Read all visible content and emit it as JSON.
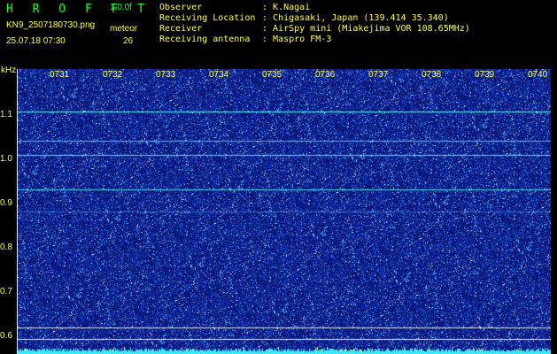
{
  "app": {
    "name": "H R O F F T",
    "version": "1.0.0f"
  },
  "file": {
    "name": "KN9_2507180730.png",
    "mode": "meteor",
    "datetime": "25.07.18 07:30",
    "count": "26"
  },
  "info": [
    {
      "label": "Observer",
      "value": ": K.Nagai"
    },
    {
      "label": "Receiving Location",
      "value": ": Chigasaki, Japan (139.414 35.340)"
    },
    {
      "label": "Receiver",
      "value": ": AirSpy mini (Miakejima VOR 108.65MHz)"
    },
    {
      "label": "Receiving antenna",
      "value": ": Maspro FM-3"
    }
  ],
  "axis": {
    "y_unit": "kHz",
    "y_labels": [
      "1.1",
      "1.0",
      "0.9",
      "0.8",
      "0.7",
      "0.6"
    ],
    "y_values": [
      1.1,
      1.0,
      0.9,
      0.8,
      0.7,
      0.6
    ],
    "x_labels": [
      "0731",
      "0732",
      "0733",
      "0734",
      "0735",
      "0736",
      "0737",
      "0738",
      "0739",
      "0740"
    ]
  },
  "colors": {
    "label_green": "#19ff19",
    "label_yellow": "#ffff3c",
    "background_blue": "#0a1470",
    "trace_cyan": "#50ffff",
    "trace_white": "#ffffff"
  }
}
